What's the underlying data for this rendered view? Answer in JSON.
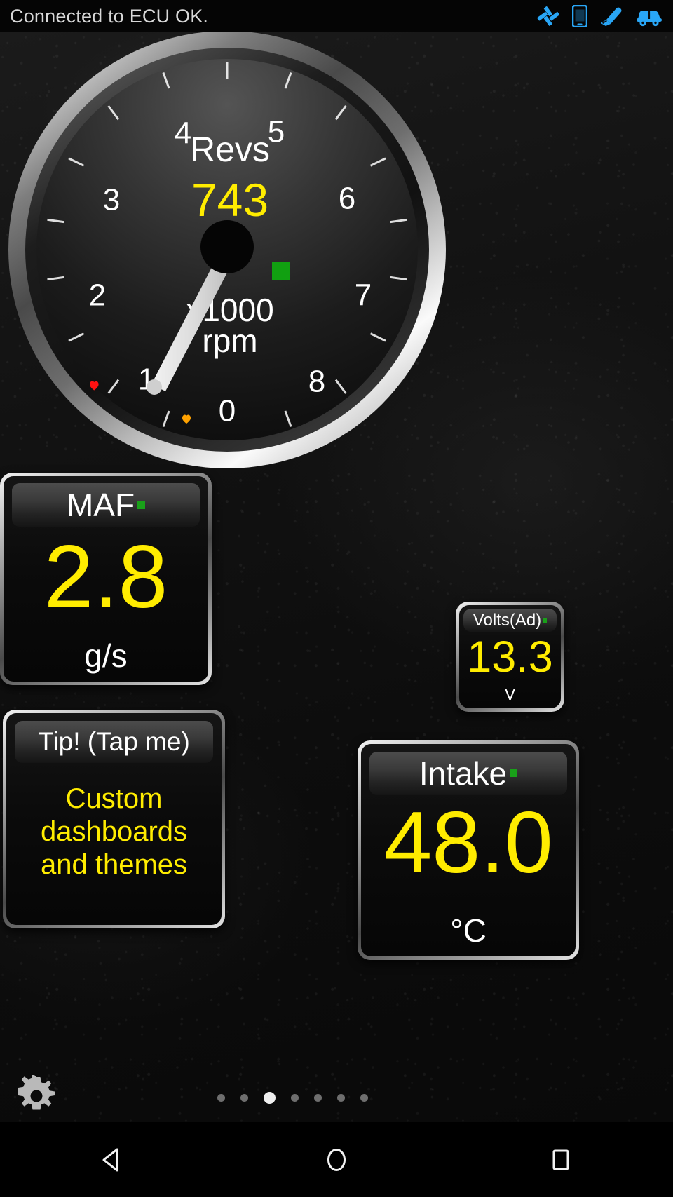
{
  "status_bar": {
    "text": "Connected to ECU OK.",
    "icons": [
      "bluetooth-satellite-icon",
      "phone-icon",
      "obd-plug-icon",
      "car-icon"
    ],
    "icon_color": "#29a6f6"
  },
  "gauge": {
    "name": "revs-gauge",
    "title": "Revs",
    "value": "743",
    "unit_line1": "x1000",
    "unit_line2": "rpm",
    "ticks": [
      "0",
      "1",
      "2",
      "3",
      "4",
      "5",
      "6",
      "7",
      "8"
    ],
    "value_color": "#ffec00",
    "title_color": "#ffffff",
    "min_marker_color": "#ff1111",
    "max_marker_color": "#ffa200",
    "status_led_color": "#11a011"
  },
  "panels": [
    {
      "name": "maf",
      "label": "MAF",
      "value": "2.8",
      "unit": "g/s",
      "live": true
    },
    {
      "name": "volts",
      "label": "Volts(Ad)",
      "value": "13.3",
      "unit": "V",
      "live": true
    },
    {
      "name": "intake",
      "label": "Intake",
      "value": "48.0",
      "unit": "°C",
      "live": true
    }
  ],
  "tip_panel": {
    "name": "tip",
    "label": "Tip! (Tap me)",
    "body": "Custom dashboards and themes"
  },
  "bottom": {
    "settings_icon": "gear-icon",
    "page_count": 7,
    "active_page": 3
  },
  "nav_bar": {
    "back": "back-icon",
    "home": "home-icon",
    "recents": "recents-icon"
  },
  "chart_data": {
    "type": "gauge",
    "title": "Revs",
    "value": 743,
    "display_value": "743",
    "unit": "x1000 rpm",
    "scale_min": 0,
    "scale_max": 8000,
    "tick_labels": [
      "0",
      "1",
      "2",
      "3",
      "4",
      "5",
      "6",
      "7",
      "8"
    ],
    "tick_values": [
      0,
      1000,
      2000,
      3000,
      4000,
      5000,
      6000,
      7000,
      8000
    ],
    "needle_value": 743,
    "min_marker_value": 1000,
    "max_marker_value": 250,
    "readouts": [
      {
        "label": "MAF",
        "value": 2.8,
        "unit": "g/s"
      },
      {
        "label": "Volts(Ad)",
        "value": 13.3,
        "unit": "V"
      },
      {
        "label": "Intake",
        "value": 48.0,
        "unit": "°C"
      }
    ]
  }
}
